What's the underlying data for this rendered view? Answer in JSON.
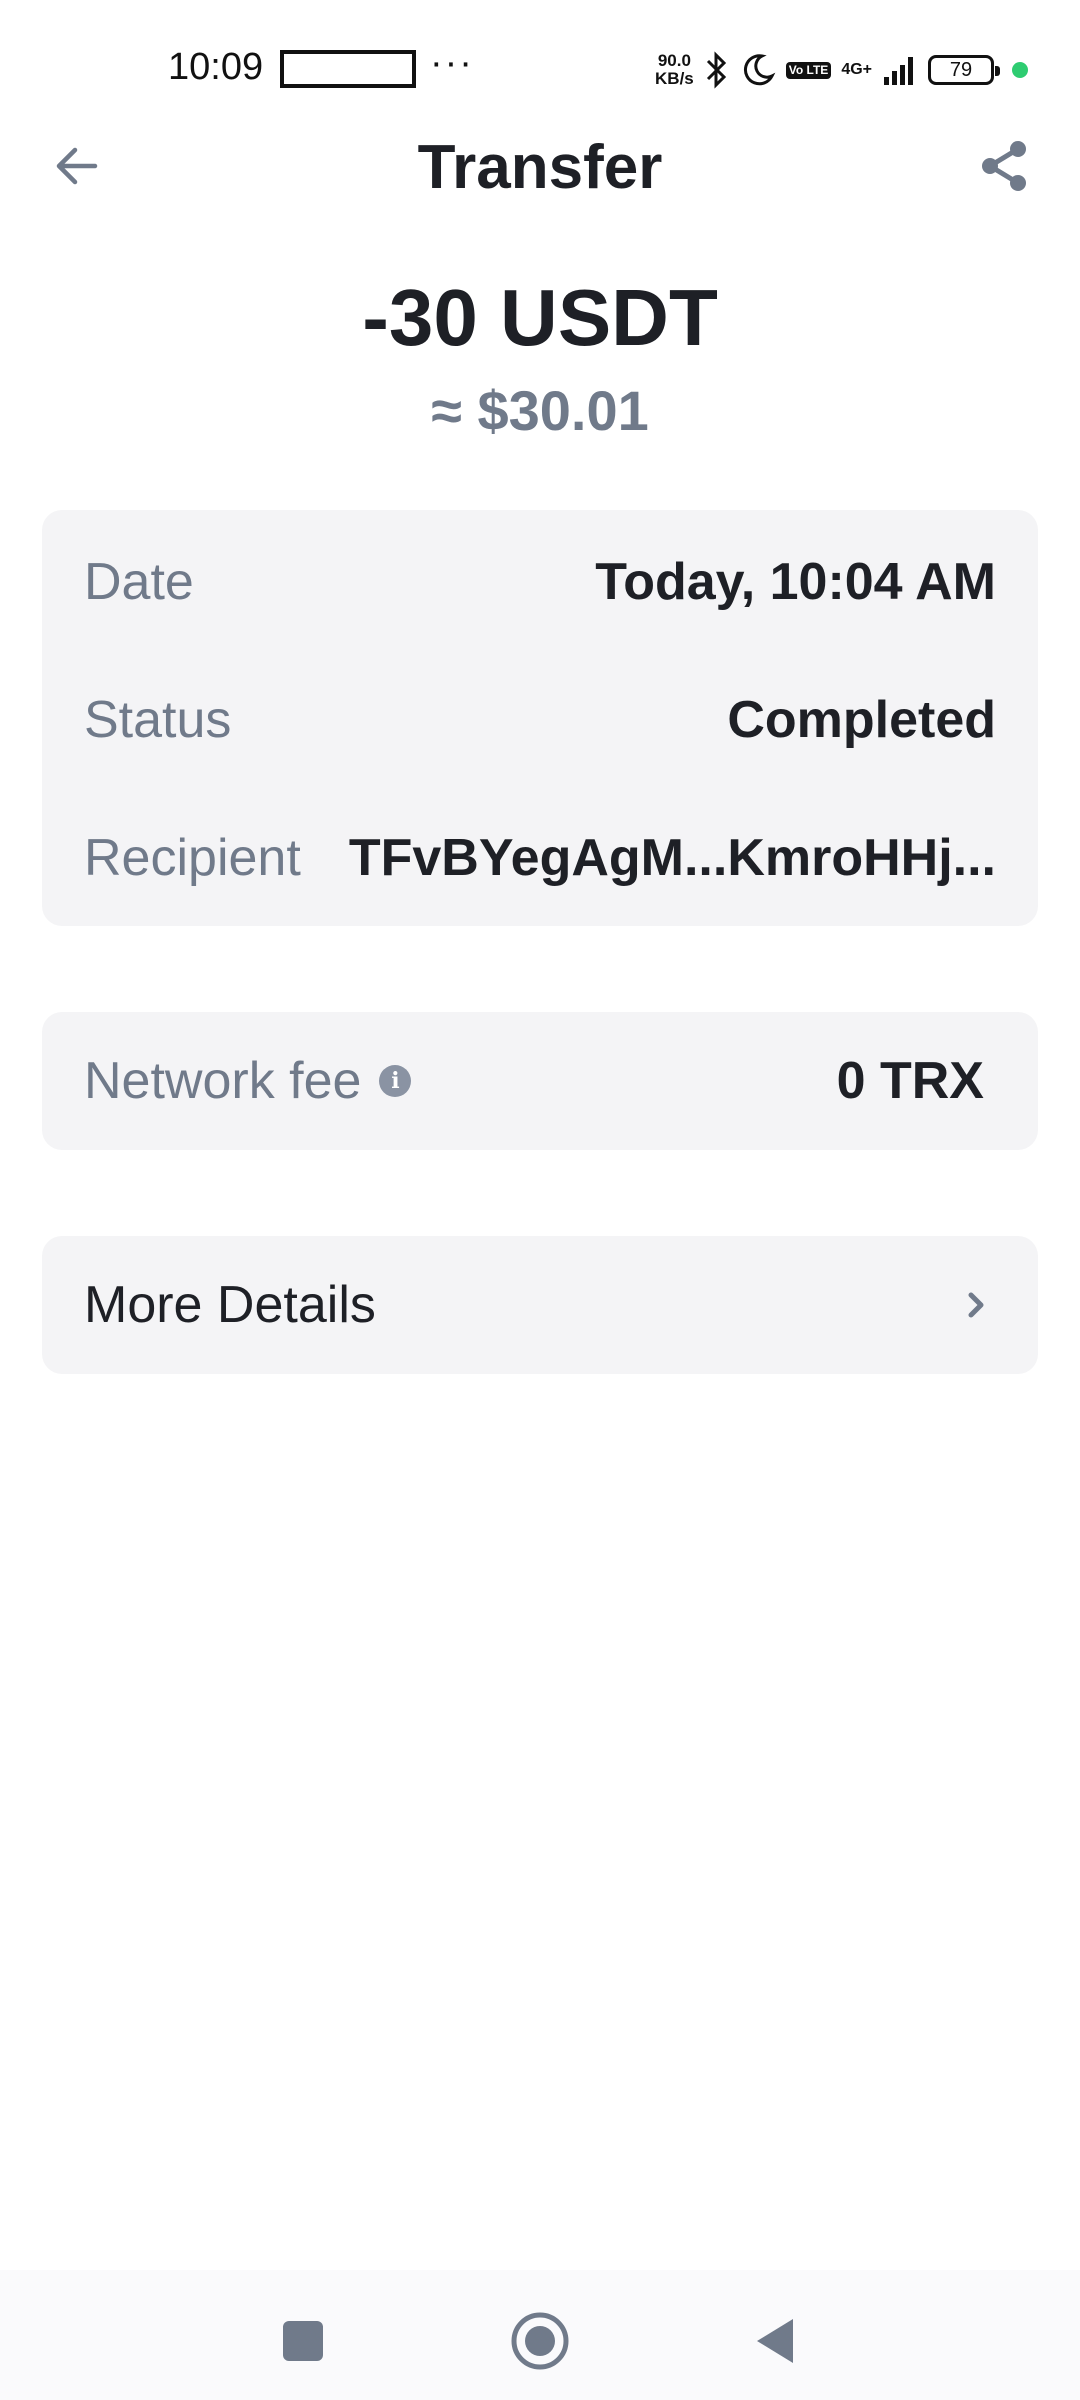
{
  "status_bar": {
    "time": "10:09",
    "dots": "···",
    "net_speed_value": "90.0",
    "net_speed_unit": "KB/s",
    "volte": "Vo LTE",
    "network": "4G+",
    "battery": "79",
    "icons": [
      "bluetooth-icon",
      "moon-icon",
      "signal-icon"
    ],
    "dot_color": "#2ecc71"
  },
  "header": {
    "title": "Transfer",
    "back_icon": "arrow-left-icon",
    "share_icon": "share-icon"
  },
  "amount": {
    "value": "-30 USDT",
    "fiat": "≈ $30.01"
  },
  "details": {
    "date_label": "Date",
    "date_value": "Today, 10:04 AM",
    "status_label": "Status",
    "status_value": "Completed",
    "recipient_label": "Recipient",
    "recipient_value": "TFvBYegAgM...KmroHHj..."
  },
  "fee": {
    "label": "Network fee",
    "info_icon": "info-icon",
    "value": "0 TRX"
  },
  "more": {
    "label": "More Details",
    "icon": "chevron-right-icon"
  },
  "navbar": {
    "icons": [
      "recent-apps-icon",
      "home-icon",
      "back-triangle-icon"
    ]
  },
  "colors": {
    "primary_text": "#1e2026",
    "secondary_text": "#707a8a",
    "card_bg": "#f4f4f6",
    "icon_gray": "#8a93a3"
  }
}
